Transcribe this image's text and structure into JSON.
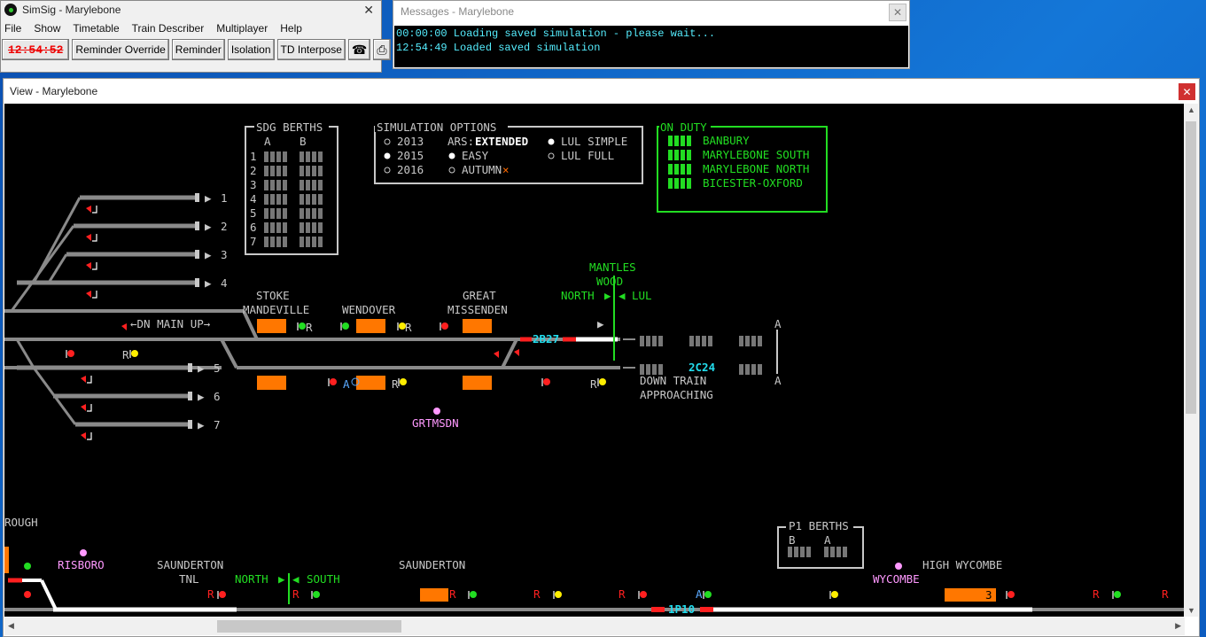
{
  "main_window": {
    "title": "SimSig - Marylebone",
    "menu": [
      "File",
      "Show",
      "Timetable",
      "Train Describer",
      "Multiplayer",
      "Help"
    ],
    "clock": "12:54:52",
    "buttons": [
      "Reminder Override",
      "Reminder",
      "Isolation",
      "TD Interpose"
    ],
    "icons": [
      "telephone-icon",
      "printer-icon"
    ]
  },
  "messages_window": {
    "title": "Messages - Marylebone",
    "lines": [
      "00:00:00 Loading saved simulation - please wait...",
      "12:54:49 Loaded saved simulation"
    ]
  },
  "view_window": {
    "title": "View - Marylebone",
    "sdg_berths": {
      "title": "SDG BERTHS",
      "col_a": "A",
      "col_b": "B",
      "rows": [
        "1",
        "2",
        "3",
        "4",
        "5",
        "6",
        "7"
      ]
    },
    "sim_options": {
      "title": "SIMULATION OPTIONS",
      "years": [
        "2013",
        "2015",
        "2016"
      ],
      "ars_label": "ARS:",
      "ars_value": "EXTENDED",
      "easy": "EASY",
      "autumn": "AUTUMN",
      "lul_simple": "LUL SIMPLE",
      "lul_full": "LUL FULL"
    },
    "on_duty": {
      "title": "ON DUTY",
      "items": [
        "BANBURY",
        "MARYLEBONE SOUTH",
        "MARYLEBONE NORTH",
        "BICESTER-OXFORD"
      ]
    },
    "sidings_upper": [
      "1",
      "2",
      "3",
      "4"
    ],
    "sidings_lower": [
      "5",
      "6",
      "7"
    ],
    "labels": {
      "dn_main_up": "DN MAIN UP",
      "stoke_1": "STOKE",
      "stoke_2": "MANDEVILLE",
      "wendover": "WENDOVER",
      "great_1": "GREAT",
      "great_2": "MISSENDEN",
      "mantles_1": "MANTLES",
      "mantles_2": "WOOD",
      "north": "NORTH",
      "lul": "LUL",
      "down_train_1": "DOWN TRAIN",
      "down_train_2": "APPROACHING",
      "grtmsdn": "GRTMSDN",
      "a_top": "A",
      "a_bottom": "A",
      "r": "R",
      "rough": "ROUGH",
      "risboro": "RISBORO",
      "saunderton_1": "SAUNDERTON",
      "saunderton_tnl": "TNL",
      "north2": "NORTH",
      "south": "SOUTH",
      "saunderton_2": "SAUNDERTON",
      "high_wycombe": "HIGH WYCOMBE",
      "wycombe": "WYCOMBE",
      "p1_berths": "P1 BERTHS",
      "p1_b": "B",
      "p1_a": "A",
      "platform_3": "3"
    },
    "trains": {
      "upper": "2B27",
      "lower": "2C24",
      "bottom": "1P10"
    },
    "colors": {
      "track": "#8a8a8a",
      "label": "#c8c8c8",
      "green": "#22dd22",
      "cyan": "#22ddee",
      "orange": "#ff7700",
      "signal_red": "#ff2020",
      "signal_yellow": "#ffee00",
      "pink": "#ff99ff"
    }
  }
}
